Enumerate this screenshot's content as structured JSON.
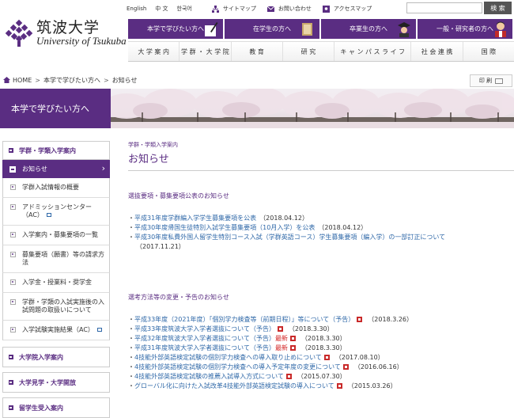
{
  "logo": {
    "ja": "筑波大学",
    "en": "University of Tsukuba"
  },
  "utility": {
    "languages": [
      "English",
      "中 文",
      "한국어"
    ],
    "links": [
      "サイトマップ",
      "お問い合わせ",
      "アクセスマップ"
    ],
    "search_button": "検 索"
  },
  "audience_tabs": [
    "本学で学びたい方へ",
    "在学生の方へ",
    "卒業生の方へ",
    "一般・研究者の方へ"
  ],
  "global_nav": [
    "大 学 案 内",
    "学 群 ・ 大 学 院",
    "教 育",
    "研 究",
    "キ ャ ン パ ス ラ イ フ",
    "社 会 連 携",
    "国 際"
  ],
  "breadcrumb": [
    "HOME",
    "本学で学びたい方へ",
    "お知らせ"
  ],
  "print_label": "印 刷",
  "banner_title": "本学で学びたい方へ",
  "sidebar": {
    "section_title": "学群・学類入学案内",
    "active_item": "お知らせ",
    "sub_items": [
      "学群入試情報の概要",
      "アドミッションセンター（AC）",
      "入学案内・募集要項の一覧",
      "募集要項（願書）等の請求方法",
      "入学金・授業料・奨学金",
      "学群・学類の入試実施後の入試問題の取扱いについて",
      "入学試験実施結果（AC）"
    ],
    "main_items": [
      "大学院入学案内",
      "大学見学・大学開放",
      "留学生受入案内"
    ]
  },
  "main": {
    "kicker": "学群・学類入学案内",
    "title": "お知らせ",
    "section1_title": "選抜要項・募集要項公表のお知らせ",
    "section1_items": [
      {
        "text": "平成31年度学群編入学学生募集要項を公表",
        "date": "（2018.04.12）"
      },
      {
        "text": "平成30年度帰国生徒特別入試学生募集要項（10月入学）を公表",
        "date": "（2018.04.12）"
      },
      {
        "text": "平成30年度私費外国人留学生特別コース入試（学群英語コース）学生募集要項（編入学）の一部訂正について",
        "date": "（2017.11.21）"
      }
    ],
    "section2_title": "選考方法等の変更・予告のお知らせ",
    "section2_items": [
      {
        "text": "平成33年度（2021年度）「個別学力検査等（前期日程）」等について（予告）",
        "new": "",
        "date": "（2018.3.26）"
      },
      {
        "text": "平成33年度筑波大学入学者選抜について（予告）",
        "new": "",
        "date": "（2018.3.30）"
      },
      {
        "text": "平成32年度筑波大学入学者選抜について（予告）",
        "new": "最新",
        "date": "（2018.3.30）"
      },
      {
        "text": "平成31年度筑波大学入学者選抜について（予告）",
        "new": "最新",
        "date": "（2018.3.30）"
      },
      {
        "text": "4技能外部英語検定試験の個別学力検査への導入取り止めについて",
        "new": "",
        "date": "（2017.08.10）"
      },
      {
        "text": "4技能外部英語検定試験の個別学力検査への導入予定年度の変更について",
        "new": "",
        "date": "（2016.06.16）"
      },
      {
        "text": "4技能外部英語検定試験の推薦入試導入方式について",
        "new": "",
        "date": "（2015.07.30）"
      },
      {
        "text": "グローバル化に向けた入試改革4技能外部英語検定試験の導入について",
        "new": "",
        "date": "（2015.03.26）"
      }
    ]
  },
  "colors": {
    "brand_purple": "#5a2d82",
    "link_blue": "#2f68a8",
    "new_red": "#d21f1f"
  }
}
